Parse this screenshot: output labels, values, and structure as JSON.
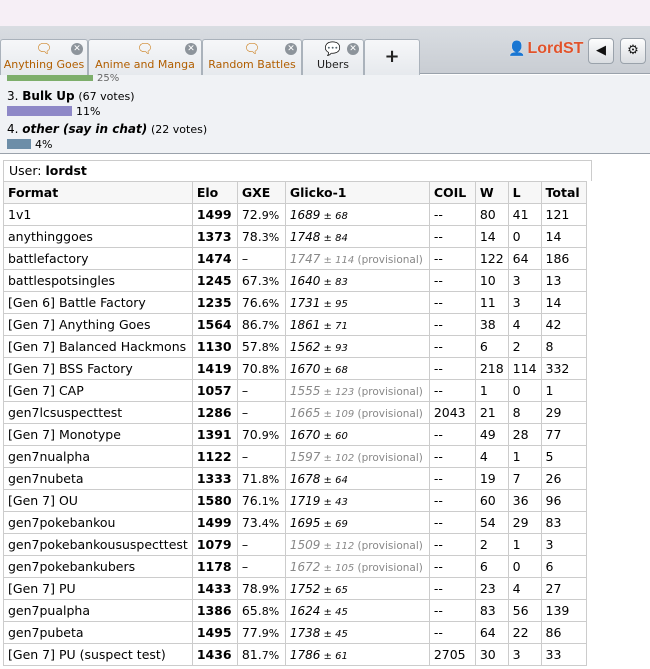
{
  "tabs": [
    {
      "label": "Anything Goes",
      "icon": "chat-bubbles-icon"
    },
    {
      "label": "Anime and Manga",
      "icon": "chat-bubbles-icon"
    },
    {
      "label": "Random Battles",
      "icon": "chat-bubbles-icon"
    },
    {
      "label": "Ubers",
      "icon": "chat-bubble-icon"
    }
  ],
  "new_tab_label": "+",
  "user": {
    "name": "LordST"
  },
  "poll": {
    "top_cut_pct": "25%",
    "options": [
      {
        "label": "3. ",
        "name": "Bulk Up",
        "votes": "(67 votes)",
        "pct": "11%",
        "percent": 11,
        "color": "#8e88c7",
        "italic": false
      },
      {
        "label": "4. ",
        "name": "other (say in chat)",
        "votes": "(22 votes)",
        "pct": "4%",
        "percent": 4,
        "color": "#6d8ea8",
        "italic": true
      }
    ]
  },
  "ladder": {
    "user_label": "User: ",
    "user": "lordst",
    "headers": [
      "Format",
      "Elo",
      "GXE",
      "Glicko-1",
      "COIL",
      "W",
      "L",
      "Total"
    ],
    "rows": [
      {
        "format": "1v1",
        "elo": "1499",
        "gxe_int": "72.",
        "gxe_dec": "9%",
        "glicko": "1689",
        "dev": " ± 68",
        "prov": "",
        "coil": "--",
        "w": "80",
        "l": "41",
        "total": "121"
      },
      {
        "format": "anythinggoes",
        "elo": "1373",
        "gxe_int": "78.",
        "gxe_dec": "3%",
        "glicko": "1748",
        "dev": " ± 84",
        "prov": "",
        "coil": "--",
        "w": "14",
        "l": "0",
        "total": "14"
      },
      {
        "format": "battlefactory",
        "elo": "1474",
        "gxe_int": "–",
        "gxe_dec": "",
        "glicko": "1747",
        "dev": " ± 114",
        "prov": " (provisional)",
        "coil": "--",
        "w": "122",
        "l": "64",
        "total": "186"
      },
      {
        "format": "battlespotsingles",
        "elo": "1245",
        "gxe_int": "67.",
        "gxe_dec": "3%",
        "glicko": "1640",
        "dev": " ± 83",
        "prov": "",
        "coil": "--",
        "w": "10",
        "l": "3",
        "total": "13"
      },
      {
        "format": "[Gen 6] Battle Factory",
        "elo": "1235",
        "gxe_int": "76.",
        "gxe_dec": "6%",
        "glicko": "1731",
        "dev": " ± 95",
        "prov": "",
        "coil": "--",
        "w": "11",
        "l": "3",
        "total": "14"
      },
      {
        "format": "[Gen 7] Anything Goes",
        "elo": "1564",
        "gxe_int": "86.",
        "gxe_dec": "7%",
        "glicko": "1861",
        "dev": " ± 71",
        "prov": "",
        "coil": "--",
        "w": "38",
        "l": "4",
        "total": "42"
      },
      {
        "format": "[Gen 7] Balanced Hackmons",
        "elo": "1130",
        "gxe_int": "57.",
        "gxe_dec": "8%",
        "glicko": "1562",
        "dev": " ± 93",
        "prov": "",
        "coil": "--",
        "w": "6",
        "l": "2",
        "total": "8"
      },
      {
        "format": "[Gen 7] BSS Factory",
        "elo": "1419",
        "gxe_int": "70.",
        "gxe_dec": "8%",
        "glicko": "1670",
        "dev": " ± 68",
        "prov": "",
        "coil": "--",
        "w": "218",
        "l": "114",
        "total": "332"
      },
      {
        "format": "[Gen 7] CAP",
        "elo": "1057",
        "gxe_int": "–",
        "gxe_dec": "",
        "glicko": "1555",
        "dev": " ± 123",
        "prov": " (provisional)",
        "coil": "--",
        "w": "1",
        "l": "0",
        "total": "1"
      },
      {
        "format": "gen7lcsuspecttest",
        "elo": "1286",
        "gxe_int": "–",
        "gxe_dec": "",
        "glicko": "1665",
        "dev": " ± 109",
        "prov": " (provisional)",
        "coil": "2043",
        "w": "21",
        "l": "8",
        "total": "29"
      },
      {
        "format": "[Gen 7] Monotype",
        "elo": "1391",
        "gxe_int": "70.",
        "gxe_dec": "9%",
        "glicko": "1670",
        "dev": " ± 60",
        "prov": "",
        "coil": "--",
        "w": "49",
        "l": "28",
        "total": "77"
      },
      {
        "format": "gen7nualpha",
        "elo": "1122",
        "gxe_int": "–",
        "gxe_dec": "",
        "glicko": "1597",
        "dev": " ± 102",
        "prov": " (provisional)",
        "coil": "--",
        "w": "4",
        "l": "1",
        "total": "5"
      },
      {
        "format": "gen7nubeta",
        "elo": "1333",
        "gxe_int": "71.",
        "gxe_dec": "8%",
        "glicko": "1678",
        "dev": " ± 64",
        "prov": "",
        "coil": "--",
        "w": "19",
        "l": "7",
        "total": "26"
      },
      {
        "format": "[Gen 7] OU",
        "elo": "1580",
        "gxe_int": "76.",
        "gxe_dec": "1%",
        "glicko": "1719",
        "dev": " ± 43",
        "prov": "",
        "coil": "--",
        "w": "60",
        "l": "36",
        "total": "96"
      },
      {
        "format": "gen7pokebankou",
        "elo": "1499",
        "gxe_int": "73.",
        "gxe_dec": "4%",
        "glicko": "1695",
        "dev": " ± 69",
        "prov": "",
        "coil": "--",
        "w": "54",
        "l": "29",
        "total": "83"
      },
      {
        "format": "gen7pokebankoususpecttest",
        "elo": "1079",
        "gxe_int": "–",
        "gxe_dec": "",
        "glicko": "1509",
        "dev": " ± 112",
        "prov": " (provisional)",
        "coil": "--",
        "w": "2",
        "l": "1",
        "total": "3"
      },
      {
        "format": "gen7pokebankubers",
        "elo": "1178",
        "gxe_int": "–",
        "gxe_dec": "",
        "glicko": "1672",
        "dev": " ± 105",
        "prov": " (provisional)",
        "coil": "--",
        "w": "6",
        "l": "0",
        "total": "6"
      },
      {
        "format": "[Gen 7] PU",
        "elo": "1433",
        "gxe_int": "78.",
        "gxe_dec": "9%",
        "glicko": "1752",
        "dev": " ± 65",
        "prov": "",
        "coil": "--",
        "w": "23",
        "l": "4",
        "total": "27"
      },
      {
        "format": "gen7pualpha",
        "elo": "1386",
        "gxe_int": "65.",
        "gxe_dec": "8%",
        "glicko": "1624",
        "dev": " ± 45",
        "prov": "",
        "coil": "--",
        "w": "83",
        "l": "56",
        "total": "139"
      },
      {
        "format": "gen7pubeta",
        "elo": "1495",
        "gxe_int": "77.",
        "gxe_dec": "9%",
        "glicko": "1738",
        "dev": " ± 45",
        "prov": "",
        "coil": "--",
        "w": "64",
        "l": "22",
        "total": "86"
      },
      {
        "format": "[Gen 7] PU (suspect test)",
        "elo": "1436",
        "gxe_int": "81.",
        "gxe_dec": "7%",
        "glicko": "1786",
        "dev": " ± 61",
        "prov": "",
        "coil": "2705",
        "w": "30",
        "l": "3",
        "total": "33"
      }
    ]
  }
}
